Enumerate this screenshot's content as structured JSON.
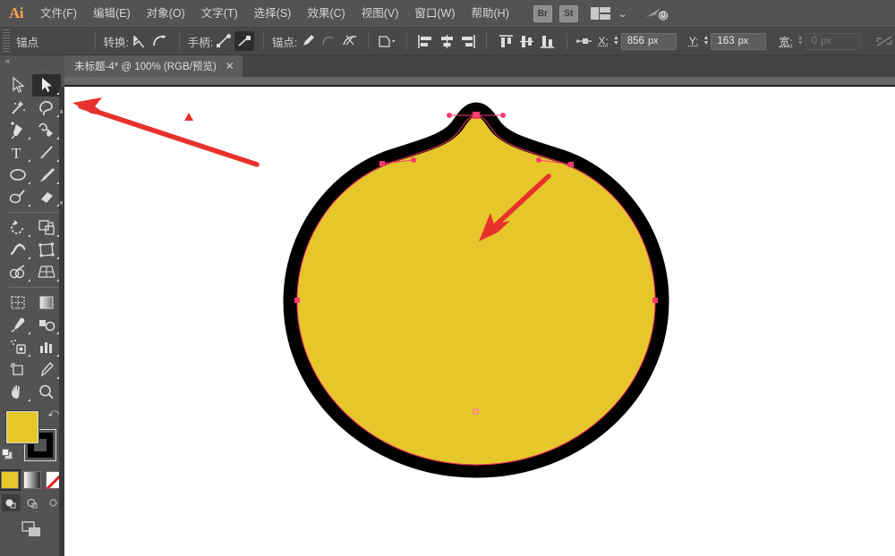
{
  "app": {
    "name": "Adobe Illustrator",
    "logo_text": "Ai"
  },
  "menubar": {
    "items": [
      {
        "label": "文件(F)",
        "name": "menu-file"
      },
      {
        "label": "编辑(E)",
        "name": "menu-edit"
      },
      {
        "label": "对象(O)",
        "name": "menu-object"
      },
      {
        "label": "文字(T)",
        "name": "menu-type"
      },
      {
        "label": "选择(S)",
        "name": "menu-select"
      },
      {
        "label": "效果(C)",
        "name": "menu-effect"
      },
      {
        "label": "视图(V)",
        "name": "menu-view"
      },
      {
        "label": "窗口(W)",
        "name": "menu-window"
      },
      {
        "label": "帮助(H)",
        "name": "menu-help"
      }
    ],
    "bridge_label": "Br",
    "stock_label": "St",
    "workspace_chevron": "⌄"
  },
  "controlbar": {
    "context_label": "锚点",
    "convert_label": "转换:",
    "handles_label": "手柄:",
    "anchor_label": "锚点:",
    "x_label": "X:",
    "x_value": "856",
    "x_unit": "px",
    "y_label": "Y:",
    "y_value": "163",
    "y_unit": "px",
    "width_label": "宽:",
    "width_value": "0",
    "width_unit": "px",
    "stepper_up": "▲",
    "stepper_down": "▼"
  },
  "tabs": {
    "collapse_icon": "«",
    "active": {
      "title": "未标题-4* @ 100% (RGB/预览)",
      "close": "✕"
    }
  },
  "tools": {
    "panel_title": "",
    "items": [
      {
        "name": "tool-selection",
        "label": "选择工具",
        "active": false
      },
      {
        "name": "tool-direct-selection",
        "label": "直接选择工具",
        "active": true
      },
      {
        "name": "tool-magic-wand",
        "label": "魔棒工具",
        "active": false
      },
      {
        "name": "tool-lasso",
        "label": "套索工具",
        "active": false
      },
      {
        "name": "tool-pen",
        "label": "钢笔工具",
        "active": false
      },
      {
        "name": "tool-curvature",
        "label": "曲率工具",
        "active": false
      },
      {
        "name": "tool-type",
        "label": "文字工具",
        "active": false
      },
      {
        "name": "tool-line-segment",
        "label": "直线段工具",
        "active": false
      },
      {
        "name": "tool-ellipse",
        "label": "椭圆工具",
        "active": false
      },
      {
        "name": "tool-paintbrush",
        "label": "画笔工具",
        "active": false
      },
      {
        "name": "tool-shaper",
        "label": "Shaper 工具",
        "active": false
      },
      {
        "name": "tool-eraser",
        "label": "橡皮擦工具",
        "active": false
      },
      {
        "name": "tool-rotate",
        "label": "旋转工具",
        "active": false
      },
      {
        "name": "tool-scale",
        "label": "比例缩放工具",
        "active": false
      },
      {
        "name": "tool-width",
        "label": "宽度工具",
        "active": false
      },
      {
        "name": "tool-free-transform",
        "label": "自由变换工具",
        "active": false
      },
      {
        "name": "tool-shape-builder",
        "label": "形状生成器工具",
        "active": false
      },
      {
        "name": "tool-perspective-grid",
        "label": "透视网格工具",
        "active": false
      },
      {
        "name": "tool-mesh",
        "label": "网格工具",
        "active": false
      },
      {
        "name": "tool-gradient",
        "label": "渐变工具",
        "active": false
      },
      {
        "name": "tool-eyedropper",
        "label": "吸管工具",
        "active": false
      },
      {
        "name": "tool-blend",
        "label": "混合工具",
        "active": false
      },
      {
        "name": "tool-symbol-sprayer",
        "label": "符号喷枪工具",
        "active": false
      },
      {
        "name": "tool-column-graph",
        "label": "柱形图工具",
        "active": false
      },
      {
        "name": "tool-artboard",
        "label": "画板工具",
        "active": false
      },
      {
        "name": "tool-slice",
        "label": "切片工具",
        "active": false
      },
      {
        "name": "tool-hand",
        "label": "抓手工具",
        "active": false
      },
      {
        "name": "tool-zoom",
        "label": "缩放工具",
        "active": false
      }
    ],
    "fill_color": "#e6c72b",
    "stroke_color": "#000000",
    "swap_icon": "⤺",
    "mode_color_label": "颜色",
    "mode_gradient_label": "渐变",
    "mode_none_label": "无",
    "screen_mode_label": "更改屏幕模式"
  },
  "artwork": {
    "shape_name": "persimmon-path",
    "fill": "#e6c72b",
    "stroke": "#000000",
    "stroke_width": 14,
    "path_highlight_color": "#ff2a6a",
    "anchor_color": "#ff3b6e"
  },
  "annotations": {
    "color": "#e8312c",
    "arrow_1_name": "arrow-to-toolbar",
    "arrow_2_name": "arrow-to-anchor-peak",
    "marker_name": "red-triangle-marker"
  }
}
